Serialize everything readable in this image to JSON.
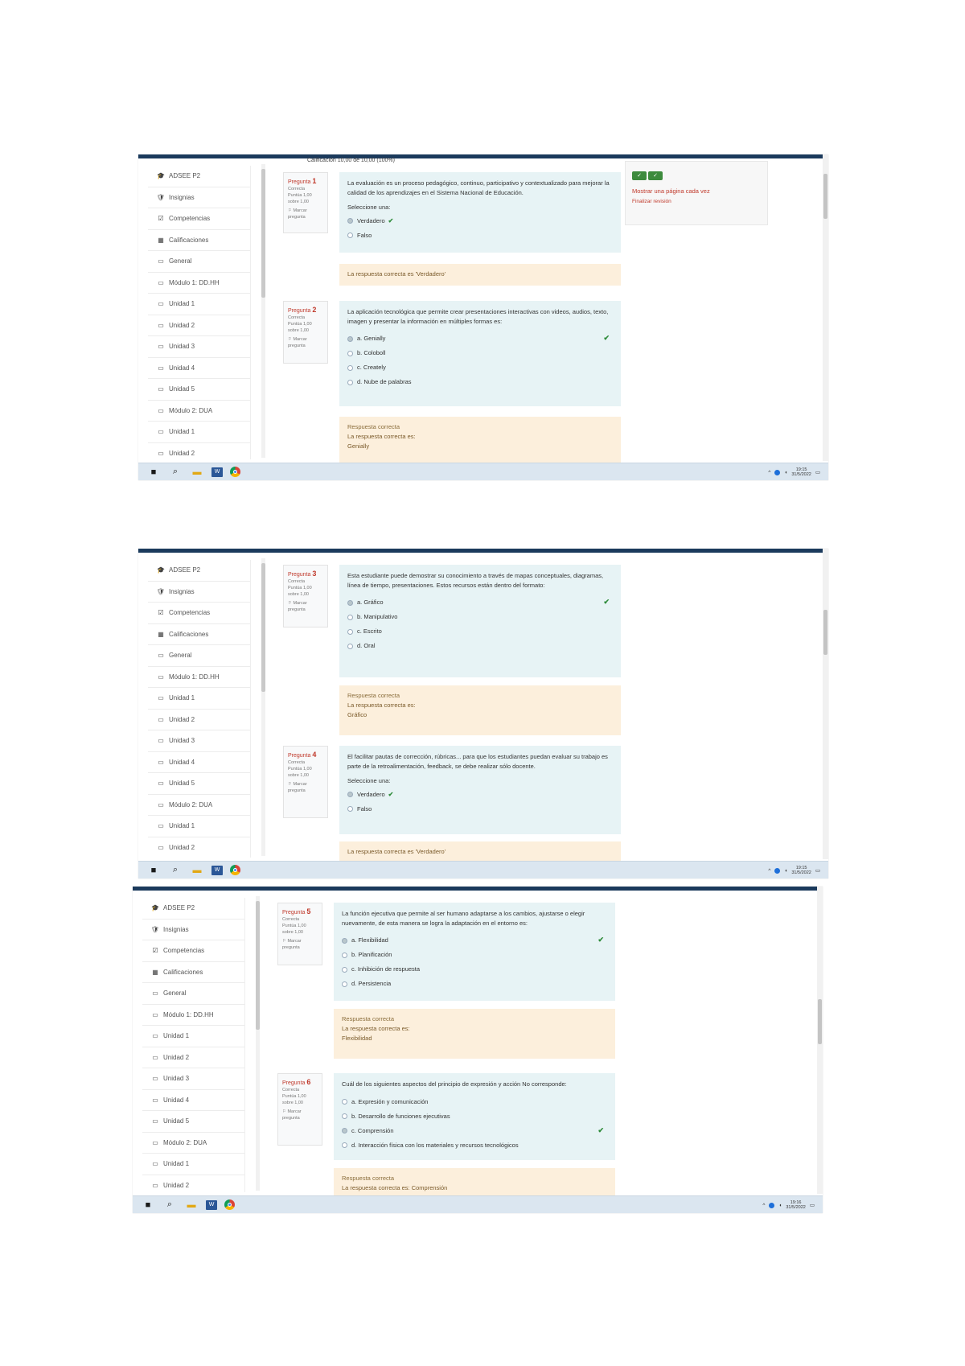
{
  "sidebar_sets": [
    [
      {
        "icon": "graduation-cap",
        "glyph": "🎓",
        "label": "ADSEE P2"
      },
      {
        "icon": "shield",
        "glyph": "🛡",
        "label": "Insignias"
      },
      {
        "icon": "checklist",
        "glyph": "☑",
        "label": "Competencias"
      },
      {
        "icon": "table",
        "glyph": "▦",
        "label": "Calificaciones"
      },
      {
        "icon": "folder",
        "glyph": "▭",
        "label": "General"
      },
      {
        "icon": "folder",
        "glyph": "▭",
        "label": "Módulo 1: DD.HH"
      },
      {
        "icon": "folder",
        "glyph": "▭",
        "label": "Unidad 1"
      },
      {
        "icon": "folder",
        "glyph": "▭",
        "label": "Unidad 2"
      },
      {
        "icon": "folder",
        "glyph": "▭",
        "label": "Unidad 3"
      },
      {
        "icon": "folder",
        "glyph": "▭",
        "label": "Unidad 4"
      },
      {
        "icon": "folder",
        "glyph": "▭",
        "label": "Unidad 5"
      },
      {
        "icon": "folder",
        "glyph": "▭",
        "label": "Módulo 2: DUA"
      },
      {
        "icon": "folder",
        "glyph": "▭",
        "label": "Unidad 1"
      },
      {
        "icon": "folder",
        "glyph": "▭",
        "label": "Unidad 2"
      }
    ]
  ],
  "screenshot1": {
    "header_fragment": "Calificación    10,00 de 10,00 (100%)",
    "right_panel": {
      "nav_buttons": [
        "✓",
        "✓"
      ],
      "show_one_page": "Mostrar una página cada vez",
      "finish_review": "Finalizar revisión"
    },
    "questions": [
      {
        "label": "Pregunta",
        "number": "1",
        "status": "Correcta",
        "score": "Puntúa 1,00 sobre 1,00",
        "flag": "Marcar pregunta",
        "text": "La evaluación es un proceso pedagógico, continuo, participativo y contextualizado para mejorar la calidad de los aprendizajes en el Sistema Nacional de Educación.",
        "prompt": "Seleccione una:",
        "answers": [
          {
            "text": "Verdadero",
            "selected": true,
            "correct": true
          },
          {
            "text": "Falso",
            "selected": false,
            "correct": false
          }
        ],
        "feedback_title": "",
        "feedback_text": "La respuesta correcta es 'Verdadero'",
        "feedback_answer": ""
      },
      {
        "label": "Pregunta",
        "number": "2",
        "status": "Correcta",
        "score": "Puntúa 1,00 sobre 1,00",
        "flag": "Marcar pregunta",
        "text": "La aplicación tecnológica que permite crear presentaciones interactivas con videos, audios, texto, imagen y presentar la información en múltiples formas es:",
        "prompt": "",
        "answers": [
          {
            "text": "a. Genially",
            "selected": true,
            "correct": true
          },
          {
            "text": "b. Coloboll",
            "selected": false,
            "correct": false
          },
          {
            "text": "c. Creately",
            "selected": false,
            "correct": false
          },
          {
            "text": "d. Nube de palabras",
            "selected": false,
            "correct": false
          }
        ],
        "feedback_title": "Respuesta correcta",
        "feedback_text": "La respuesta correcta es:",
        "feedback_answer": "Genially"
      }
    ]
  },
  "screenshot2": {
    "questions": [
      {
        "label": "Pregunta",
        "number": "3",
        "status": "Correcta",
        "score": "Puntúa 1,00 sobre 1,00",
        "flag": "Marcar pregunta",
        "text": "Esta estudiante puede demostrar su conocimiento a través de mapas conceptuales, diagramas, línea de tiempo, presentaciones. Estos recursos están dentro del formato:",
        "prompt": "",
        "answers": [
          {
            "text": "a. Gráfico",
            "selected": true,
            "correct": true
          },
          {
            "text": "b. Manipulativo",
            "selected": false,
            "correct": false
          },
          {
            "text": "c. Escrito",
            "selected": false,
            "correct": false
          },
          {
            "text": "d. Oral",
            "selected": false,
            "correct": false
          }
        ],
        "feedback_title": "Respuesta correcta",
        "feedback_text": "La respuesta correcta es:",
        "feedback_answer": "Gráfico"
      },
      {
        "label": "Pregunta",
        "number": "4",
        "status": "Correcta",
        "score": "Puntúa 1,00 sobre 1,00",
        "flag": "Marcar pregunta",
        "text": "El facilitar pautas de corrección, rúbricas... para que los estudiantes puedan evaluar su trabajo es parte de la retroalimentación, feedback, se debe realizar sólo docente.",
        "prompt": "Seleccione una:",
        "answers": [
          {
            "text": "Verdadero",
            "selected": true,
            "correct": true
          },
          {
            "text": "Falso",
            "selected": false,
            "correct": false
          }
        ],
        "feedback_title": "",
        "feedback_text": "La respuesta correcta es 'Verdadero'",
        "feedback_answer": ""
      }
    ]
  },
  "screenshot3": {
    "questions": [
      {
        "label": "Pregunta",
        "number": "5",
        "status": "Correcta",
        "score": "Puntúa 1,00 sobre 1,00",
        "flag": "Marcar pregunta",
        "text": "La función ejecutiva que permite al ser humano adaptarse a los cambios, ajustarse o elegir nuevamente, de esta manera se logra la adaptación en el entorno es:",
        "prompt": "",
        "answers": [
          {
            "text": "a. Flexibilidad",
            "selected": true,
            "correct": true
          },
          {
            "text": "b. Planificación",
            "selected": false,
            "correct": false
          },
          {
            "text": "c. Inhibición de respuesta",
            "selected": false,
            "correct": false
          },
          {
            "text": "d. Persistencia",
            "selected": false,
            "correct": false
          }
        ],
        "feedback_title": "Respuesta correcta",
        "feedback_text": "La respuesta correcta es:",
        "feedback_answer": "Flexibilidad"
      },
      {
        "label": "Pregunta",
        "number": "6",
        "status": "Correcta",
        "score": "Puntúa 1,00 sobre 1,00",
        "flag": "Marcar pregunta",
        "text": "Cuál de los siguientes aspectos del principio de expresión y acción No corresponde:",
        "prompt": "",
        "answers": [
          {
            "text": "a. Expresión y comunicación",
            "selected": false,
            "correct": false
          },
          {
            "text": "b. Desarrollo de funciones ejecutivas",
            "selected": false,
            "correct": false
          },
          {
            "text": "c. Comprensión",
            "selected": true,
            "correct": true
          },
          {
            "text": "d. Interacción física con los materiales y recursos tecnológicos",
            "selected": false,
            "correct": false
          }
        ],
        "feedback_title": "Respuesta correcta",
        "feedback_text": "La respuesta correcta es: Comprensión",
        "feedback_answer": ""
      }
    ]
  },
  "taskbar": {
    "icons": [
      "windows-start",
      "search",
      "file-explorer",
      "word",
      "chrome"
    ],
    "clocks": [
      {
        "time": "19:15",
        "date": "31/5/2022"
      },
      {
        "time": "19:15",
        "date": "31/5/2022"
      },
      {
        "time": "19:16",
        "date": "31/5/2022"
      }
    ]
  },
  "colors": {
    "topbar": "#1b3a5c",
    "question_bg": "#e7f3f5",
    "feedback_bg": "#fcefdc",
    "accent_red": "#c0392b",
    "correct_green": "#2e8b3a",
    "taskbar": "#dbe6f0"
  }
}
